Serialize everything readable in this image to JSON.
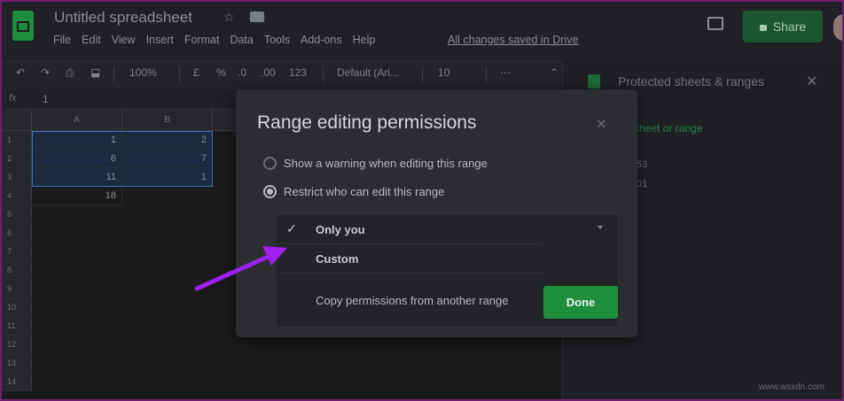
{
  "header": {
    "doc_title": "Untitled spreadsheet",
    "menu": [
      "File",
      "Edit",
      "View",
      "Insert",
      "Format",
      "Data",
      "Tools",
      "Add-ons",
      "Help"
    ],
    "saved_note": "All changes saved in Drive",
    "share_label": "Share"
  },
  "toolbar": {
    "zoom": "100%",
    "currency": "£",
    "percent": "%",
    "decimal_less": ".0",
    "decimal_more": ".00",
    "number_format": "123",
    "font": "Default (Ari...",
    "font_size": "10",
    "more": "⋯",
    "collapse": "⌃"
  },
  "formula_bar": {
    "fx": "fx",
    "value": "1"
  },
  "grid": {
    "columns": [
      "A",
      "B"
    ],
    "rows": [
      "1",
      "2",
      "3",
      "4",
      "5",
      "6",
      "7",
      "8",
      "9",
      "10",
      "11",
      "12",
      "13",
      "14"
    ],
    "col_a": [
      "1",
      "6",
      "11",
      "18"
    ],
    "col_b": [
      "2",
      "7",
      "1"
    ]
  },
  "side_panel": {
    "title": "Protected sheets & ranges",
    "add_link": "sheet or range",
    "time1": ":53",
    "time2": ":01"
  },
  "dialog": {
    "title": "Range editing permissions",
    "option_warning": "Show a warning when editing this range",
    "option_restrict": "Restrict who can edit this range",
    "dropdown_options": [
      "Only you",
      "Custom"
    ],
    "copy_label": "Copy permissions from another range",
    "done_label": "Done"
  },
  "colors": {
    "accent_green": "#1e8e3e",
    "annotation_arrow": "#a020f0"
  },
  "watermark": "www.wsxdn.com"
}
